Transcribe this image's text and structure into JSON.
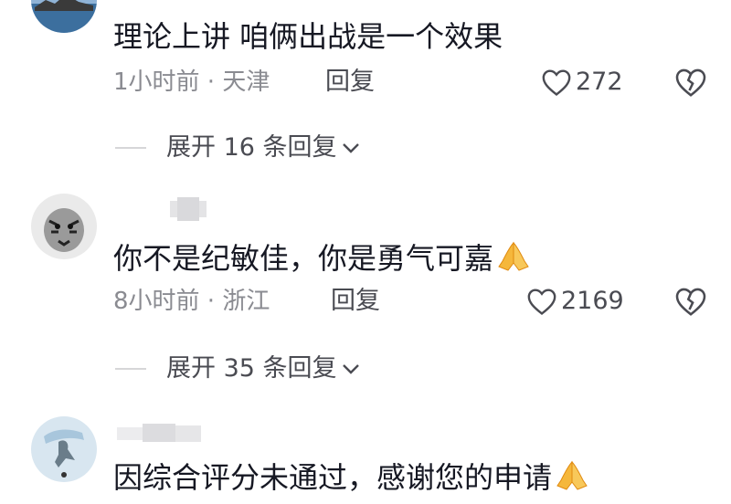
{
  "comments": [
    {
      "text": "理论上讲  咱俩出战是一个效果",
      "time_location": "1小时前 · 天津",
      "reply_label": "回复",
      "likes": "272",
      "expand_label": "展开 16 条回复"
    },
    {
      "text": "你不是纪敏佳，你是勇气可嘉",
      "time_location": "8小时前 · 浙江",
      "reply_label": "回复",
      "likes": "2169",
      "expand_label": "展开 35 条回复"
    },
    {
      "text": "因综合评分未通过，感谢您的申请"
    }
  ],
  "icons": {
    "like": "heart-outline-icon",
    "dislike": "broken-heart-icon",
    "expand": "chevron-down-icon",
    "emoji": "praying-hands-emoji"
  },
  "colors": {
    "text": "#161823",
    "meta": "#8a8b91",
    "action": "#4a4b52",
    "emoji": "#f5b73b"
  }
}
